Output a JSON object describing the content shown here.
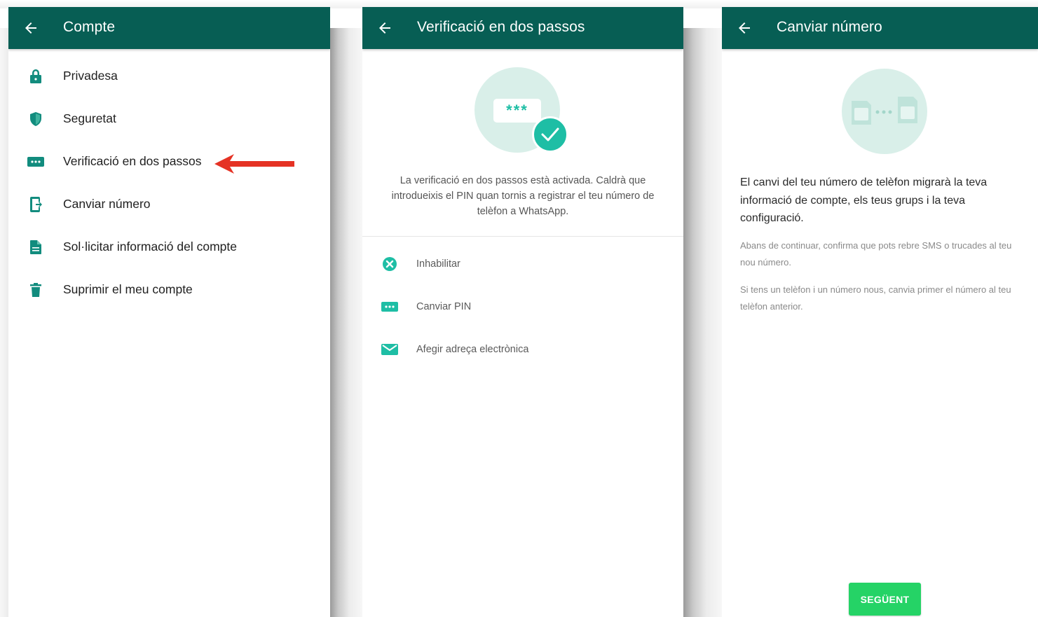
{
  "colors": {
    "appbar": "#075e54",
    "accent": "#1ebea5",
    "icon": "#128c7e",
    "button": "#25d366",
    "arrow": "#e53224"
  },
  "screen1": {
    "title": "Compte",
    "items": [
      {
        "label": "Privadesa",
        "icon": "lock-icon"
      },
      {
        "label": "Seguretat",
        "icon": "shield-icon"
      },
      {
        "label": "Verificació en dos passos",
        "icon": "dots-icon"
      },
      {
        "label": "Canviar número",
        "icon": "phone-change-icon"
      },
      {
        "label": "Sol·licitar informació del compte",
        "icon": "document-icon"
      },
      {
        "label": "Suprimir el meu compte",
        "icon": "trash-icon"
      }
    ]
  },
  "screen2": {
    "title": "Verificació en dos passos",
    "pin_mask": "***",
    "description": "La verificació en dos passos està activada. Caldrà que introdueixis el PIN quan tornis a registrar el teu número de telèfon a WhatsApp.",
    "options": [
      {
        "label": "Inhabilitar",
        "icon": "close-circle-icon"
      },
      {
        "label": "Canviar PIN",
        "icon": "dots-icon"
      },
      {
        "label": "Afegir adreça electrònica",
        "icon": "mail-icon"
      }
    ]
  },
  "screen3": {
    "title": "Canviar número",
    "main_text": "El canvi del teu número de telèfon migrarà la teva informació de compte, els teus grups i la teva configuració.",
    "sub_text_1": "Abans de continuar, confirma que pots rebre SMS o trucades al teu nou número.",
    "sub_text_2": "Si tens un telèfon i un número nous, canvia primer el número al teu telèfon anterior.",
    "next_button": "SEGÜENT"
  }
}
